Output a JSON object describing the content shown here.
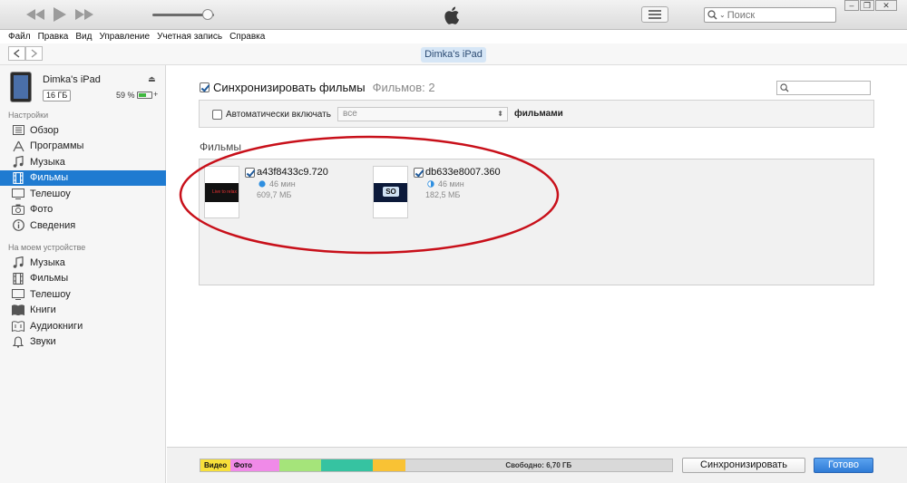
{
  "app": {
    "menu": [
      "Файл",
      "Правка",
      "Вид",
      "Управление",
      "Учетная запись",
      "Справка"
    ],
    "search_placeholder": "Поиск",
    "volume_fraction": 0.9
  },
  "nav": {
    "device_pill": "Dimka's iPad"
  },
  "device": {
    "name": "Dimka's iPad",
    "capacity": "16 ГБ",
    "battery_text": "59 %",
    "battery_fraction": 0.59
  },
  "sidebar": {
    "settings_heading": "Настройки",
    "settings_items": [
      {
        "label": "Обзор",
        "icon": "overview-icon"
      },
      {
        "label": "Программы",
        "icon": "apps-icon"
      },
      {
        "label": "Музыка",
        "icon": "music-icon"
      },
      {
        "label": "Фильмы",
        "icon": "film-icon",
        "active": true
      },
      {
        "label": "Телешоу",
        "icon": "tv-icon"
      },
      {
        "label": "Фото",
        "icon": "camera-icon"
      },
      {
        "label": "Сведения",
        "icon": "info-icon"
      }
    ],
    "device_heading": "На моем устройстве",
    "device_items": [
      {
        "label": "Музыка",
        "icon": "music-icon"
      },
      {
        "label": "Фильмы",
        "icon": "film-icon"
      },
      {
        "label": "Телешоу",
        "icon": "tv-icon"
      },
      {
        "label": "Книги",
        "icon": "book-icon"
      },
      {
        "label": "Аудиокниги",
        "icon": "audiobook-icon"
      },
      {
        "label": "Звуки",
        "icon": "bell-icon"
      }
    ]
  },
  "main": {
    "sync_label": "Синхронизировать фильмы",
    "sync_count": "Фильмов: 2",
    "auto_label": "Автоматически включать",
    "auto_select": "все",
    "auto_suffix": "фильмами",
    "films_heading": "Фильмы",
    "movies": [
      {
        "title": "a43f8433c9.720",
        "duration": "46 мин",
        "size": "609,7 МБ",
        "status_icon": "full-circle-icon",
        "poster_text": "Live to relax"
      },
      {
        "title": "db633e8007.360",
        "duration": "46 мин",
        "size": "182,5 МБ",
        "status_icon": "half-circle-icon",
        "poster_text": "SO"
      }
    ]
  },
  "bottom": {
    "segments": [
      {
        "label": "Видео",
        "color": "#f7e03a",
        "fraction": 0.063
      },
      {
        "label": "Фото",
        "color": "#f08ae8",
        "fraction": 0.105
      },
      {
        "label": "",
        "color": "#a5e47a",
        "fraction": 0.088
      },
      {
        "label": "",
        "color": "#36c3a1",
        "fraction": 0.109
      },
      {
        "label": "",
        "color": "#f9c234",
        "fraction": 0.069
      },
      {
        "label": "Свободно: 6,70 ГБ",
        "color": "#d9d9d9",
        "fraction": 0.566,
        "free": true
      }
    ],
    "sync_button": "Синхронизировать",
    "done_button": "Готово"
  },
  "colors": {
    "accent": "#1f7bd1",
    "annotation": "#c8101a"
  }
}
